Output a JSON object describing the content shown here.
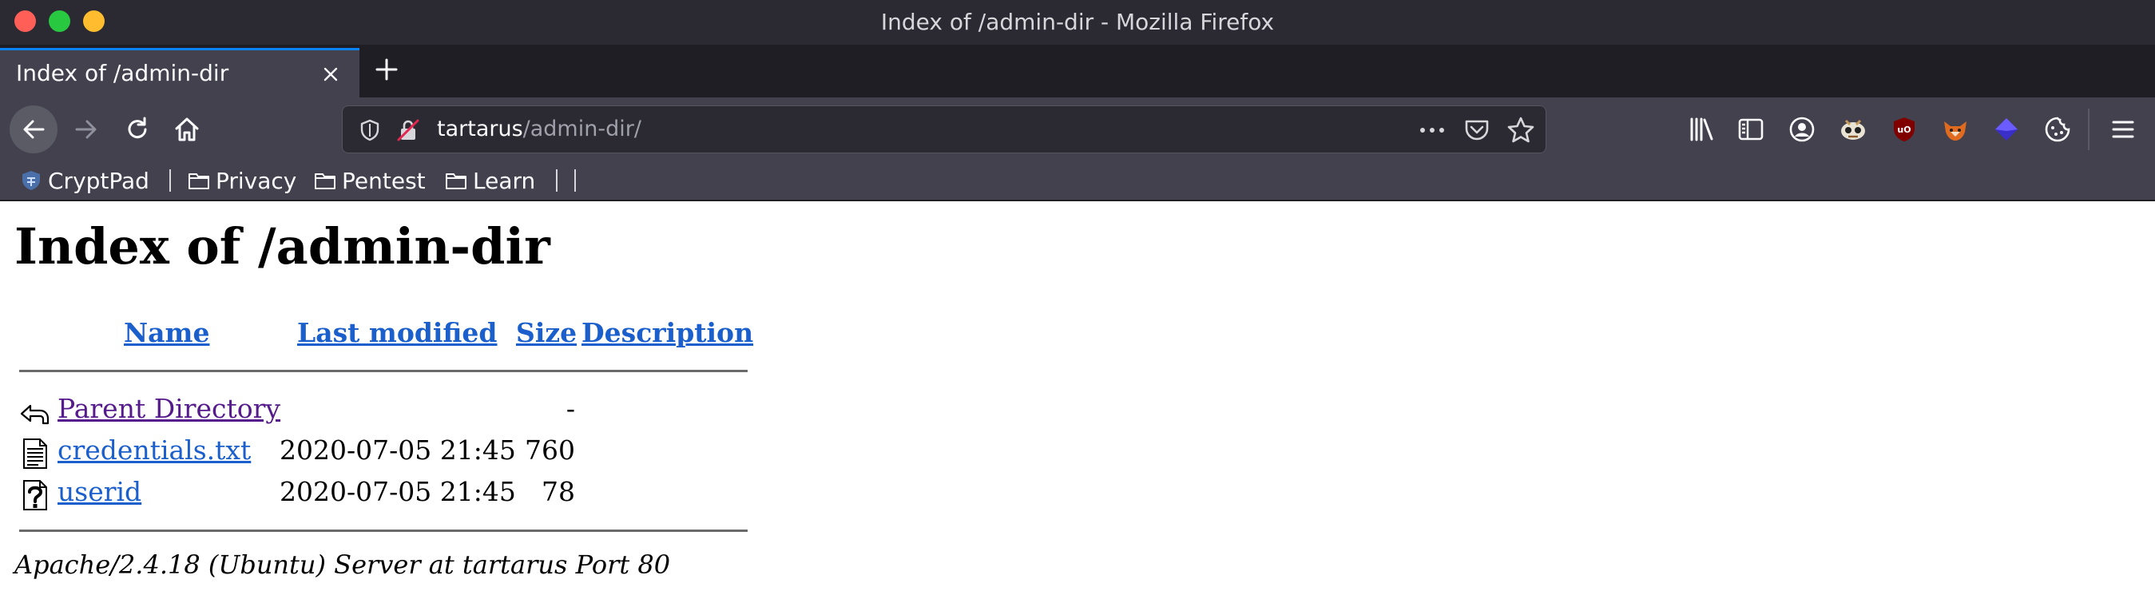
{
  "window": {
    "title": "Index of /admin-dir - Mozilla Firefox"
  },
  "tabs": [
    {
      "label": "Index of /admin-dir",
      "active": true
    }
  ],
  "urlbar": {
    "host": "tartarus",
    "path": "/admin-dir/"
  },
  "bookmarks": [
    {
      "label": "CryptPad",
      "icon": "cryptpad-icon"
    },
    {
      "label": "Privacy",
      "icon": "folder-icon"
    },
    {
      "label": "Pentest",
      "icon": "folder-icon"
    },
    {
      "label": "Learn",
      "icon": "folder-icon"
    }
  ],
  "toolbar_icons": [
    "library-icon",
    "sidebar-icon",
    "account-icon",
    "tampermonkey-icon",
    "ublock-origin-icon",
    "foxyproxy-icon",
    "layers-icon",
    "cookie-icon",
    "hamburger-menu-icon"
  ],
  "page": {
    "title": "Index of /admin-dir",
    "columns": {
      "name": "Name",
      "last_modified": "Last modified",
      "size": "Size",
      "description": "Description"
    },
    "rows": [
      {
        "name": "Parent Directory",
        "modified": "",
        "size": "-",
        "icon": "back-arrow-icon",
        "visited": true
      },
      {
        "name": "credentials.txt",
        "modified": "2020-07-05 21:45",
        "size": "760",
        "icon": "text-file-icon",
        "visited": false
      },
      {
        "name": "userid",
        "modified": "2020-07-05 21:45",
        "size": "78",
        "icon": "unknown-file-icon",
        "visited": false
      }
    ],
    "server_signature": "Apache/2.4.18 (Ubuntu) Server at tartarus Port 80"
  },
  "colors": {
    "accent": "#0a84ff",
    "link": "#1a5fcc",
    "visited": "#551a8b",
    "chrome_dark": "#2b2a33",
    "chrome": "#42414d"
  }
}
